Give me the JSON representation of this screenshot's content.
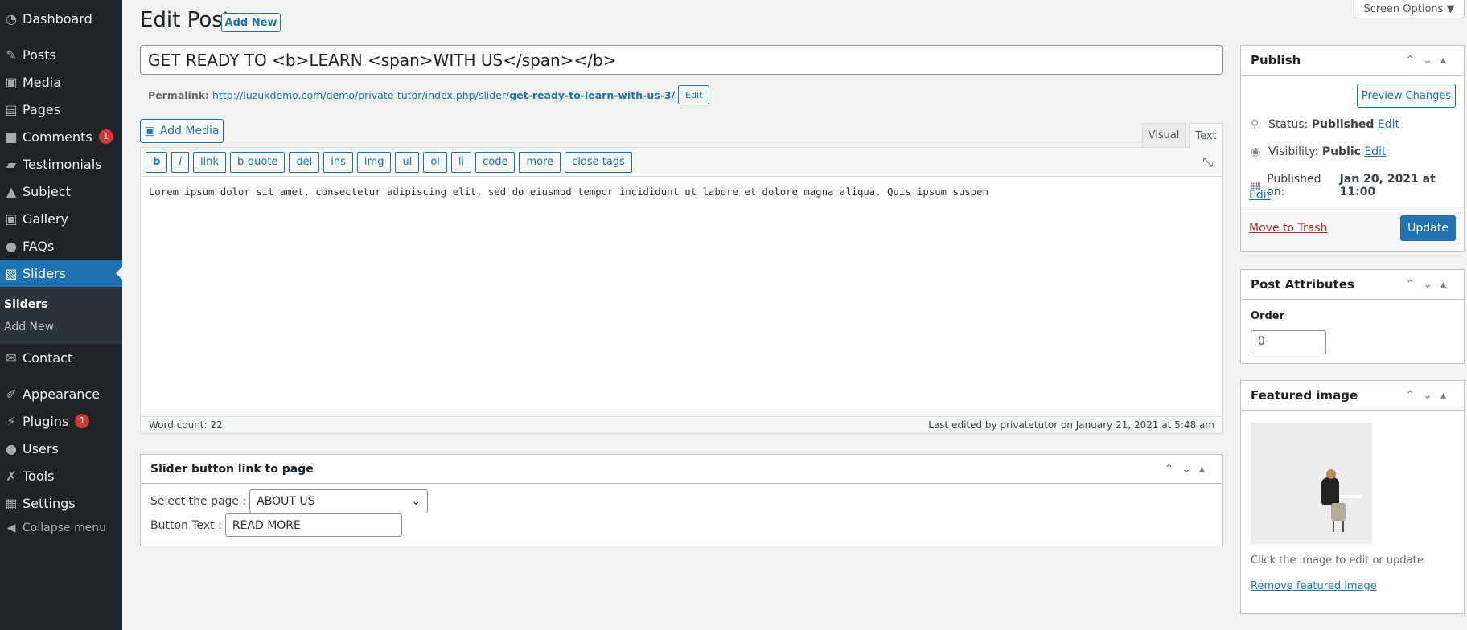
{
  "sidebar": {
    "items": [
      {
        "label": "Dashboard",
        "icon": "dashboard-icon",
        "glyph": "◔"
      },
      {
        "label": "Posts",
        "icon": "pin-icon",
        "glyph": "✎"
      },
      {
        "label": "Media",
        "icon": "media-icon",
        "glyph": "▣"
      },
      {
        "label": "Pages",
        "icon": "pages-icon",
        "glyph": "▤"
      },
      {
        "label": "Comments",
        "icon": "comment-icon",
        "glyph": "■",
        "badge": "1"
      },
      {
        "label": "Testimonials",
        "icon": "testimonials-icon",
        "glyph": "▰"
      },
      {
        "label": "Subject",
        "icon": "graduation-cap-icon",
        "glyph": "▲"
      },
      {
        "label": "Gallery",
        "icon": "gallery-icon",
        "glyph": "▣"
      },
      {
        "label": "FAQs",
        "icon": "faq-icon",
        "glyph": "●"
      },
      {
        "label": "Sliders",
        "icon": "slides-icon",
        "glyph": "▧"
      },
      {
        "label": "Contact",
        "icon": "mail-icon",
        "glyph": "✉"
      },
      {
        "label": "Appearance",
        "icon": "brush-icon",
        "glyph": "✐"
      },
      {
        "label": "Plugins",
        "icon": "plugin-icon",
        "glyph": "⚡",
        "badge": "1"
      },
      {
        "label": "Users",
        "icon": "user-icon",
        "glyph": "●"
      },
      {
        "label": "Tools",
        "icon": "wrench-icon",
        "glyph": "✗"
      },
      {
        "label": "Settings",
        "icon": "settings-icon",
        "glyph": "▦"
      }
    ],
    "submenu": [
      "Sliders",
      "Add New"
    ],
    "collapse": "Collapse menu"
  },
  "header": {
    "title": "Edit Post",
    "add_new": "Add New",
    "screen_options": "Screen Options ▼"
  },
  "post": {
    "title": "GET READY TO <b>LEARN <span>WITH US</span></b>",
    "permalink_label": "Permalink:",
    "permalink_base": "http://luzukdemo.com/demo/private-tutor/index.php/slider/",
    "permalink_slug": "get-ready-to-learn-with-us-3/",
    "permalink_edit": "Edit"
  },
  "editor": {
    "add_media": "Add Media",
    "tabs": [
      "Visual",
      "Text"
    ],
    "quicktags": [
      "b",
      "i",
      "link",
      "b-quote",
      "del",
      "ins",
      "img",
      "ul",
      "ol",
      "li",
      "code",
      "more",
      "close tags"
    ],
    "content": "Lorem ipsum dolor sit amet, consectetur adipiscing elit, sed do eiusmod tempor incididunt ut labore et dolore magna aliqua. Quis ipsum suspen",
    "word_count": "Word count: 22",
    "last_edited": "Last edited by privatetutor on January 21, 2021 at 5:48 am"
  },
  "slider_box": {
    "title": "Slider button link to page",
    "select_label": "Select the page :",
    "select_value": "ABOUT US",
    "button_label": "Button Text :",
    "button_value": "READ MORE"
  },
  "publish": {
    "title": "Publish",
    "preview": "Preview Changes",
    "status_label": "Status:",
    "status": "Published",
    "visibility_label": "Visibility:",
    "visibility": "Public",
    "published_label": "Published on:",
    "published": "Jan 20, 2021 at 11:00",
    "edit": "Edit",
    "trash": "Move to Trash",
    "update": "Update"
  },
  "attributes": {
    "title": "Post Attributes",
    "order_label": "Order",
    "order": "0"
  },
  "featured": {
    "title": "Featured image",
    "hint": "Click the image to edit or update",
    "remove": "Remove featured image"
  }
}
